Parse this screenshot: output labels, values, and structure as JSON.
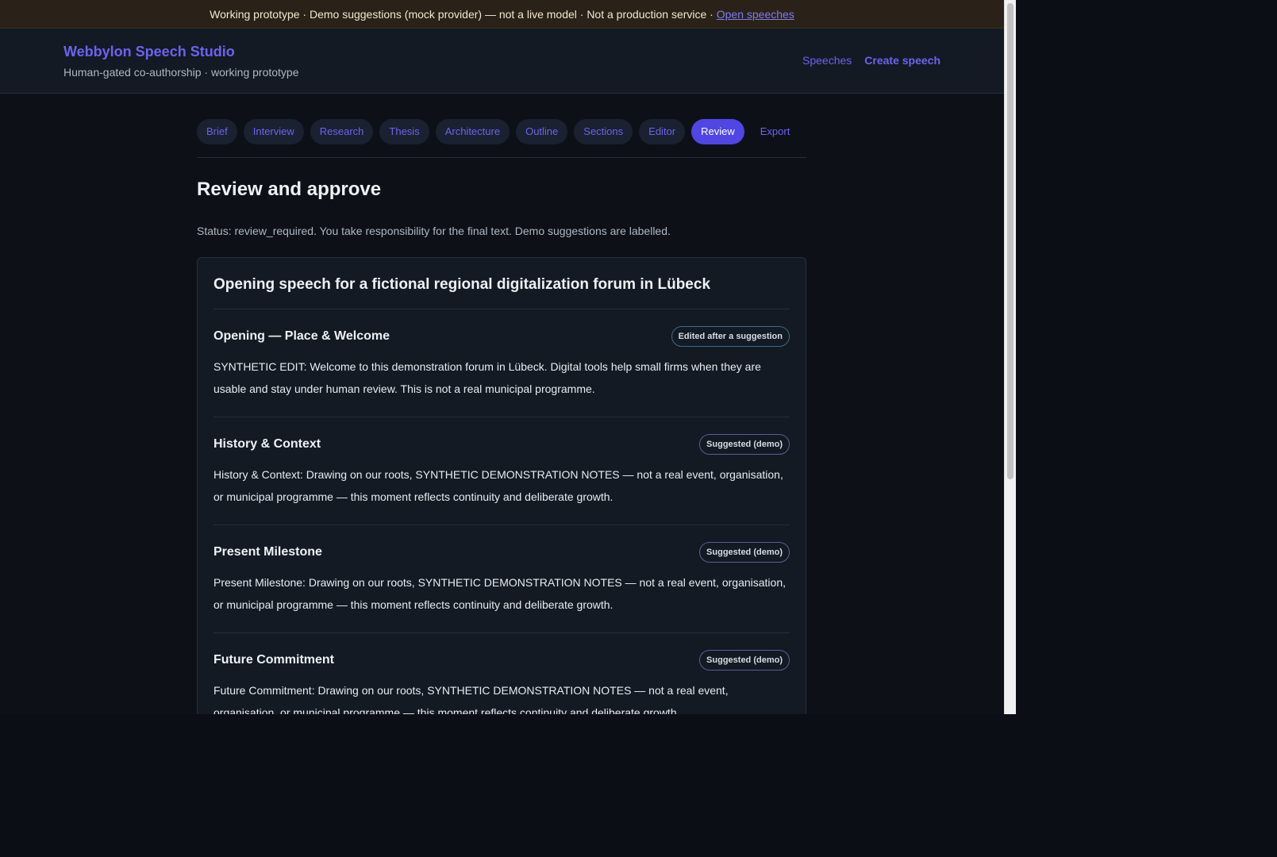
{
  "banner": {
    "text": "Working prototype · Demo suggestions (mock provider) — not a live model · Not a production service · ",
    "link_label": "Open speeches"
  },
  "header": {
    "title": "Webbylon Speech Studio",
    "subtitle": "Human-gated co-authorship · working prototype",
    "nav": {
      "speeches": "Speeches",
      "create": "Create speech"
    }
  },
  "steps": [
    "Brief",
    "Interview",
    "Research",
    "Thesis",
    "Architecture",
    "Outline",
    "Sections",
    "Editor",
    "Review",
    "Export"
  ],
  "active_step": "Review",
  "page": {
    "title": "Review and approve",
    "status": "Status: review_required. You take responsibility for the final text. Demo suggestions are labelled."
  },
  "speech": {
    "title": "Opening speech for a fictional regional digitalization forum in Lübeck",
    "sections": [
      {
        "title": "Opening — Place & Welcome",
        "badge": "Edited after a suggestion",
        "body": "SYNTHETIC EDIT: Welcome to this demonstration forum in Lübeck. Digital tools help small firms when they are usable and stay under human review. This is not a real municipal programme."
      },
      {
        "title": "History & Context",
        "badge": "Suggested (demo)",
        "body": "History & Context: Drawing on our roots, SYNTHETIC DEMONSTRATION NOTES — not a real event, organisation, or municipal programme — this moment reflects continuity and deliberate growth."
      },
      {
        "title": "Present Milestone",
        "badge": "Suggested (demo)",
        "body": "Present Milestone: Drawing on our roots, SYNTHETIC DEMONSTRATION NOTES — not a real event, organisation, or municipal programme — this moment reflects continuity and deliberate growth."
      },
      {
        "title": "Future Commitment",
        "badge": "Suggested (demo)",
        "body": "Future Commitment: Drawing on our roots, SYNTHETIC DEMONSTRATION NOTES — not a real event, organisation, or municipal programme — this moment reflects continuity and deliberate growth."
      }
    ]
  }
}
